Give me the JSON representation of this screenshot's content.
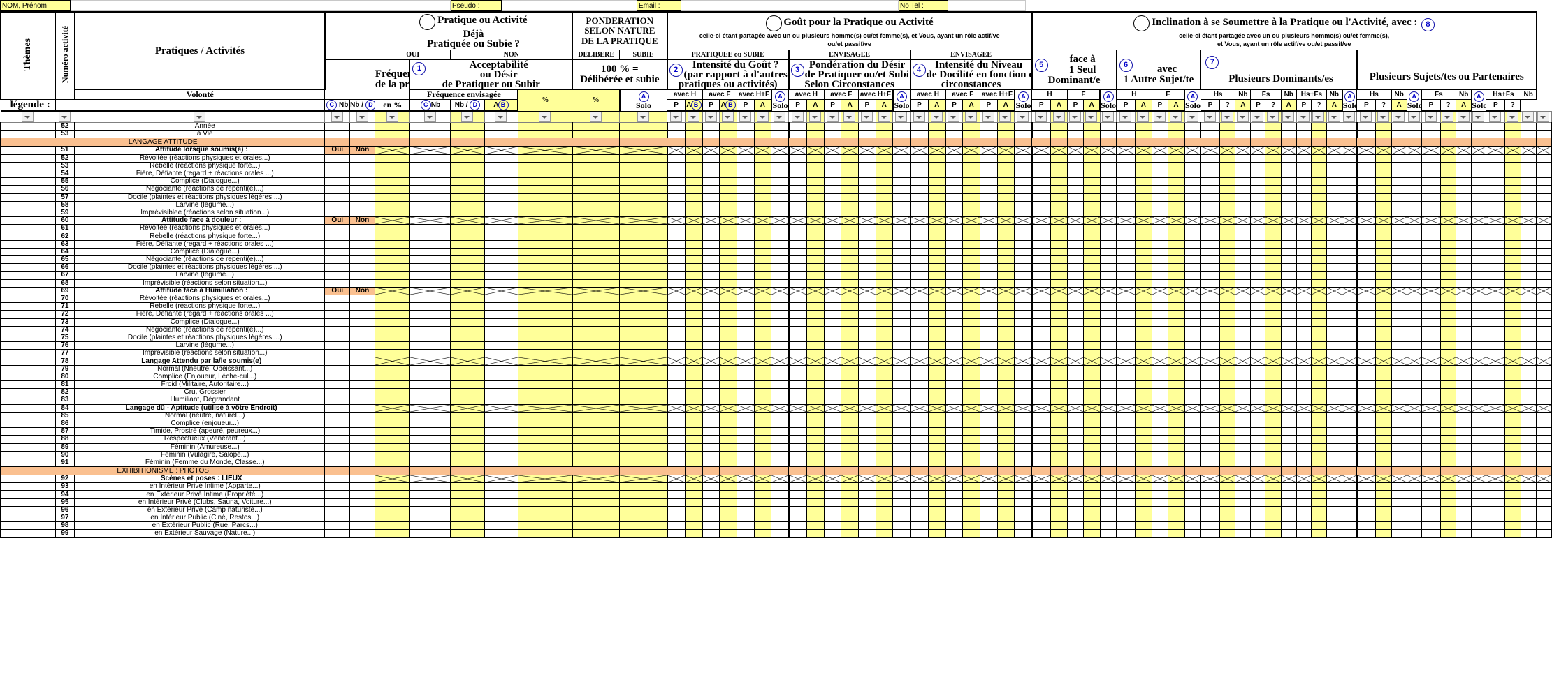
{
  "topbar": {
    "nom_label": "NOM, Prénom",
    "pseudo_label": "Pseudo :",
    "email_label": "Email :",
    "tel_label": "No Tel :"
  },
  "headers": {
    "themes": "Thèmes",
    "numero": "Numéro activité",
    "pratiques": "Pratiques / Activités",
    "legende": "légende :",
    "g1": {
      "title_l1": "Pratique  ou Activité",
      "title_l2": "Déjà",
      "title_l3": "Pratiquée ou Subie ?",
      "oui": "OUI",
      "non": "NON",
      "freq_l1": "Fréquence",
      "freq_l2": "de la pratique",
      "accept_badge": "1",
      "accept_l1": "Acceptabilité",
      "accept_l2": "ou Désir",
      "accept_l3": "de Pratiquer ou Subir",
      "volonte_l1": "Volonté",
      "volonte_l2": "en %",
      "freqenv": "Fréquence envisagée",
      "nb": "Nb",
      "nbslash": "Nb /",
      "c": "C",
      "d": "D"
    },
    "g2": {
      "title_l1": "PONDERATION",
      "title_l2": "SELON NATURE",
      "title_l3": "DE LA PRATIQUE",
      "delibere": "DELIBERE",
      "subie": "SUBIE",
      "cent_l1": "100 % =",
      "cent_l2": "Délibérée et subie",
      "pct": "%"
    },
    "g3": {
      "title": "Goût pour la Pratique ou Activité",
      "sub_l1": "celle-ci étant partagée avec un ou plusieurs homme(s) ou/et femme(s),  et Vous, ayant un rôle actif/ve",
      "sub_l2": "ou/et passif/ve",
      "pratiquee": "PRATIQUEE ou SUBIE",
      "envisagee": "ENVISAGEE",
      "b2_badge": "2",
      "b2_l1": "Intensité du Goût ?",
      "b2_l2": "(par rapport à d'autres",
      "b2_l3": "pratiques ou activités)",
      "b3_badge": "3",
      "b3_l1": "Pondération du Désir",
      "b3_l2": "de Pratiquer ou/et Subir",
      "b3_l3": "Selon Circonstances",
      "b4_badge": "4",
      "b4_l1": "Intensité du Niveau",
      "b4_l2": "de Docilité en fonction de",
      "b4_l3": "circonstances",
      "envisagee2": "ENVISAGEE"
    },
    "g4": {
      "title": "Inclination à se Soumettre à la Pratique ou l'Activité, avec :",
      "sub_l1": "celle-ci étant partagée avec un ou plusieurs homme(s) ou/et femme(s),",
      "sub_l2": "et Vous, ayant un rôle actif/ve ou/et passif/ve",
      "badge8": "8",
      "b5_badge": "5",
      "b5_l1": "face à",
      "b5_l2": "1 Seul",
      "b5_l3": "Dominant/e",
      "b6_badge": "6",
      "b6_l1": "avec",
      "b6_l2": "1 Autre Sujet/te",
      "b7_badge": "7",
      "b7_title": "Plusieurs Dominants/es",
      "b8_title": "Plusieurs Sujets/tes ou Partenaires"
    },
    "subcols": {
      "A": "A",
      "P": "P",
      "solo": "Solo",
      "badgeA": "A",
      "badgeB": "B",
      "avec_h": "avec H",
      "avec_f": "avec F",
      "avec_hf": "avec H+F",
      "H": "H",
      "F": "F",
      "Hs": "Hs",
      "Fs": "Fs",
      "HsFs": "Hs+Fs",
      "Nb": "Nb",
      "q": "?"
    }
  },
  "rows": [
    {
      "kind": "data",
      "num": "52",
      "label": "Année",
      "indent": true
    },
    {
      "kind": "data",
      "num": "53",
      "label": "à Vie",
      "indent": true
    },
    {
      "kind": "section",
      "label": "LANGAGE ATTITUDE"
    },
    {
      "kind": "head",
      "num": "51",
      "label": "Attitude lorsque soumis(e) :",
      "ouinon": true
    },
    {
      "kind": "data",
      "num": "52",
      "label": "Révoltée (réactions physiques et orales...)",
      "indent": true
    },
    {
      "kind": "data",
      "num": "53",
      "label": "Rebelle (réactions physique forte...)",
      "indent": true
    },
    {
      "kind": "data",
      "num": "54",
      "label": "Fière, Défiante (regard + réactions orales ...)",
      "indent": true
    },
    {
      "kind": "data",
      "num": "55",
      "label": "Complice (Dialogue...)",
      "indent": true
    },
    {
      "kind": "data",
      "num": "56",
      "label": "Négociante (réactions de repenti(e)...)",
      "indent": true
    },
    {
      "kind": "data",
      "num": "57",
      "label": "Docile (plaintes et réactions physiques légères ...)",
      "indent": true
    },
    {
      "kind": "data",
      "num": "58",
      "label": "Larvine (légume...)",
      "indent": true
    },
    {
      "kind": "data",
      "num": "59",
      "label": "Imprévisiblee (réactions selon situation...)",
      "indent": true
    },
    {
      "kind": "head",
      "num": "60",
      "label": "Attitude face à douleur :",
      "ouinon": true
    },
    {
      "kind": "data",
      "num": "61",
      "label": "Révoltée (réactions physiques et orales...)",
      "indent": true
    },
    {
      "kind": "data",
      "num": "62",
      "label": "Rebelle (réactions physique forte...)",
      "indent": true
    },
    {
      "kind": "data",
      "num": "63",
      "label": "Fière, Défiante (regard + réactions orales ...)",
      "indent": true
    },
    {
      "kind": "data",
      "num": "64",
      "label": "Complice (Dialogue...)",
      "indent": true
    },
    {
      "kind": "data",
      "num": "65",
      "label": "Négociante (réactions de repenti(e)...)",
      "indent": true
    },
    {
      "kind": "data",
      "num": "66",
      "label": "Docile (plaintes et réactions physiques légères ...)",
      "indent": true
    },
    {
      "kind": "data",
      "num": "67",
      "label": "Larvine (légume...)",
      "indent": true
    },
    {
      "kind": "data",
      "num": "68",
      "label": "Imprévisible (réactions selon situation...)",
      "indent": true
    },
    {
      "kind": "head",
      "num": "69",
      "label": "Attitude face à Humiliation :",
      "ouinon": true
    },
    {
      "kind": "data",
      "num": "70",
      "label": "Révoltée (réactions physiques et orales...)",
      "indent": true
    },
    {
      "kind": "data",
      "num": "71",
      "label": "Rebelle (réactions physique forte...)",
      "indent": true
    },
    {
      "kind": "data",
      "num": "72",
      "label": "Fière, Défiante (regard + réactions orales ...)",
      "indent": true
    },
    {
      "kind": "data",
      "num": "73",
      "label": "Complice (Dialogue...)",
      "indent": true
    },
    {
      "kind": "data",
      "num": "74",
      "label": "Négociante (réactions de repenti(e)...)",
      "indent": true
    },
    {
      "kind": "data",
      "num": "75",
      "label": "Docile (plaintes et réactions physiques légères ...)",
      "indent": true
    },
    {
      "kind": "data",
      "num": "76",
      "label": "Larvine (légume...)",
      "indent": true
    },
    {
      "kind": "data",
      "num": "77",
      "label": "Imprévisible (réactions selon situation...)",
      "indent": true
    },
    {
      "kind": "head",
      "num": "78",
      "label": "Langage Attendu par la/le soumis(e)",
      "ouinon": false
    },
    {
      "kind": "data",
      "num": "79",
      "label": "Normal (Nneutre, Obéissant...)",
      "indent": true
    },
    {
      "kind": "data",
      "num": "80",
      "label": "Complice (Enjoueur, Lèche-cul...)",
      "indent": true
    },
    {
      "kind": "data",
      "num": "81",
      "label": "Froid (Militaire, Autoritaire...)",
      "indent": true
    },
    {
      "kind": "data",
      "num": "82",
      "label": "Cru, Grossier",
      "indent": true
    },
    {
      "kind": "data",
      "num": "83",
      "label": "Humiliant, Dégrandant",
      "indent": true
    },
    {
      "kind": "head",
      "num": "84",
      "label": "Langage dû - Aptitude (utilisé à vôtre Endroit)",
      "ouinon": false
    },
    {
      "kind": "data",
      "num": "85",
      "label": "Normal (neutre, naturel...)",
      "indent": true
    },
    {
      "kind": "data",
      "num": "86",
      "label": "Complice (enjoueur...)",
      "indent": true
    },
    {
      "kind": "data",
      "num": "87",
      "label": "Timide, Prostré (apeuré, peureux...)",
      "indent": true
    },
    {
      "kind": "data",
      "num": "88",
      "label": "Respectueux (Vénérant...)",
      "indent": true
    },
    {
      "kind": "data",
      "num": "89",
      "label": "Féminin (Amureuse...)",
      "indent": true
    },
    {
      "kind": "data",
      "num": "90",
      "label": "Féminin (Vulagire, Salope...)",
      "indent": true
    },
    {
      "kind": "data",
      "num": "91",
      "label": "Féminin (Femme du Monde, Classe...)",
      "indent": true
    },
    {
      "kind": "section",
      "label": "EXHIBITIONISME : PHOTOS"
    },
    {
      "kind": "head",
      "num": "92",
      "label": "Scènes et poses : LIEUX",
      "ouinon": false
    },
    {
      "kind": "data",
      "num": "93",
      "label": "en Intérieur Privé Intime (Apparte...)",
      "indent": true
    },
    {
      "kind": "data",
      "num": "94",
      "label": "en Extérieur Privé Intime (Propriété...)",
      "indent": true
    },
    {
      "kind": "data",
      "num": "95",
      "label": "en Intérieur Privé (Clubs, Sauna, Voiture...)",
      "indent": true
    },
    {
      "kind": "data",
      "num": "96",
      "label": "en Extérieur Privé (Camp naturiste...)",
      "indent": true
    },
    {
      "kind": "data",
      "num": "97",
      "label": "en Intérieur Public (Ciné, Restos...)",
      "indent": true
    },
    {
      "kind": "data",
      "num": "98",
      "label": "en Extérieur Public (Rue, Parcs...)",
      "indent": true
    },
    {
      "kind": "data",
      "num": "99",
      "label": "en Extérieur Sauvage (Nature...)",
      "indent": true
    }
  ],
  "colors": {
    "yellow": "#ffff99",
    "orange": "#fac090",
    "badge_blue": "#0000cc",
    "white": "#ffffff"
  }
}
